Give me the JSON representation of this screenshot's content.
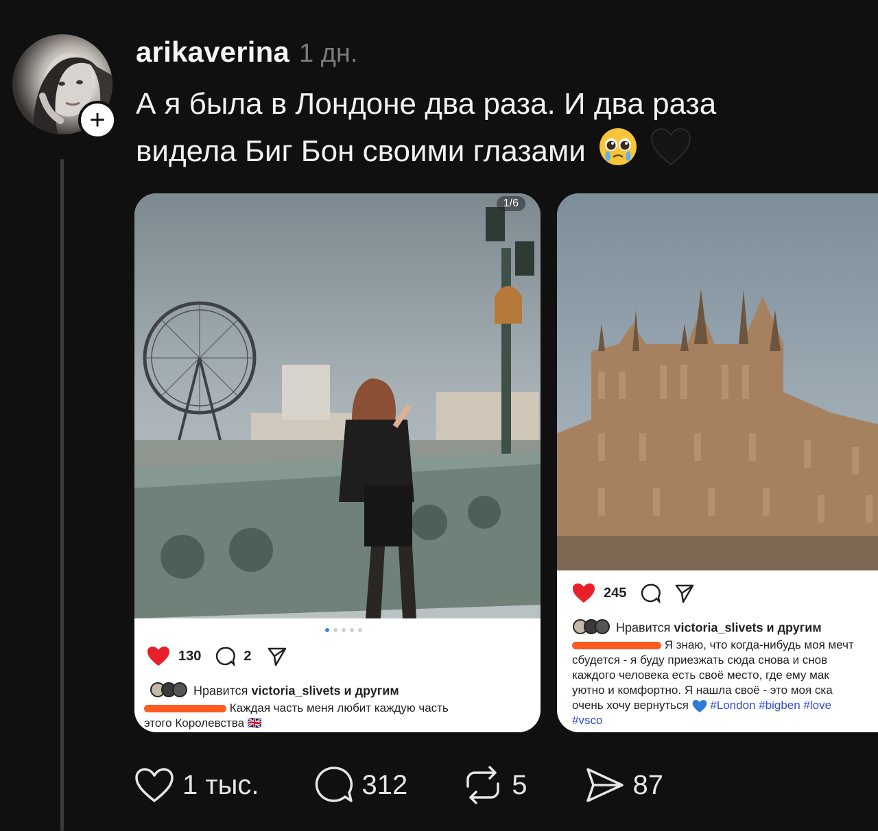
{
  "post": {
    "username": "arikaverina",
    "timestamp": "1 дн.",
    "follow_symbol": "+",
    "text_line1": "А я была в Лондоне два раза. И два раза",
    "text_line2": "видела Биг Бон своими глазами",
    "emojis": [
      "pleading-face-icon",
      "black-heart-icon"
    ]
  },
  "card1": {
    "slide_counter": "1/6",
    "likes": "130",
    "comments": "2",
    "liked_by_prefix": "Нравится",
    "liked_by_user": "victoria_slivets",
    "liked_by_suffix": "и другим",
    "caption_line1": "Каждая часть меня любит каждую часть",
    "caption_line2": "этого Королевства",
    "caption_flag": "🇬🇧"
  },
  "card2": {
    "likes": "245",
    "liked_by_prefix": "Нравится",
    "liked_by_user": "victoria_slivets",
    "liked_by_suffix": "и другим",
    "caption_line1": "Я знаю, что когда-нибудь моя мечт",
    "caption_line2": "сбудется - я буду приезжать сюда снова и снов",
    "caption_line3": "каждого человека есть своё место, где ему мак",
    "caption_line4": "уютно и комфортно. Я нашла своё - это моя ска",
    "caption_line5": "очень хочу вернуться",
    "caption_tags_line5": "#London #bigben #love",
    "caption_tags_line6": "#vsco"
  },
  "footer": {
    "likes": "1 тыс.",
    "replies": "312",
    "reposts": "5",
    "shares": "87"
  },
  "colors": {
    "background": "#101010",
    "heart_red": "#e8202b",
    "hashtag_blue": "#2e4bd6",
    "redaction_orange": "#ff5a1f"
  }
}
